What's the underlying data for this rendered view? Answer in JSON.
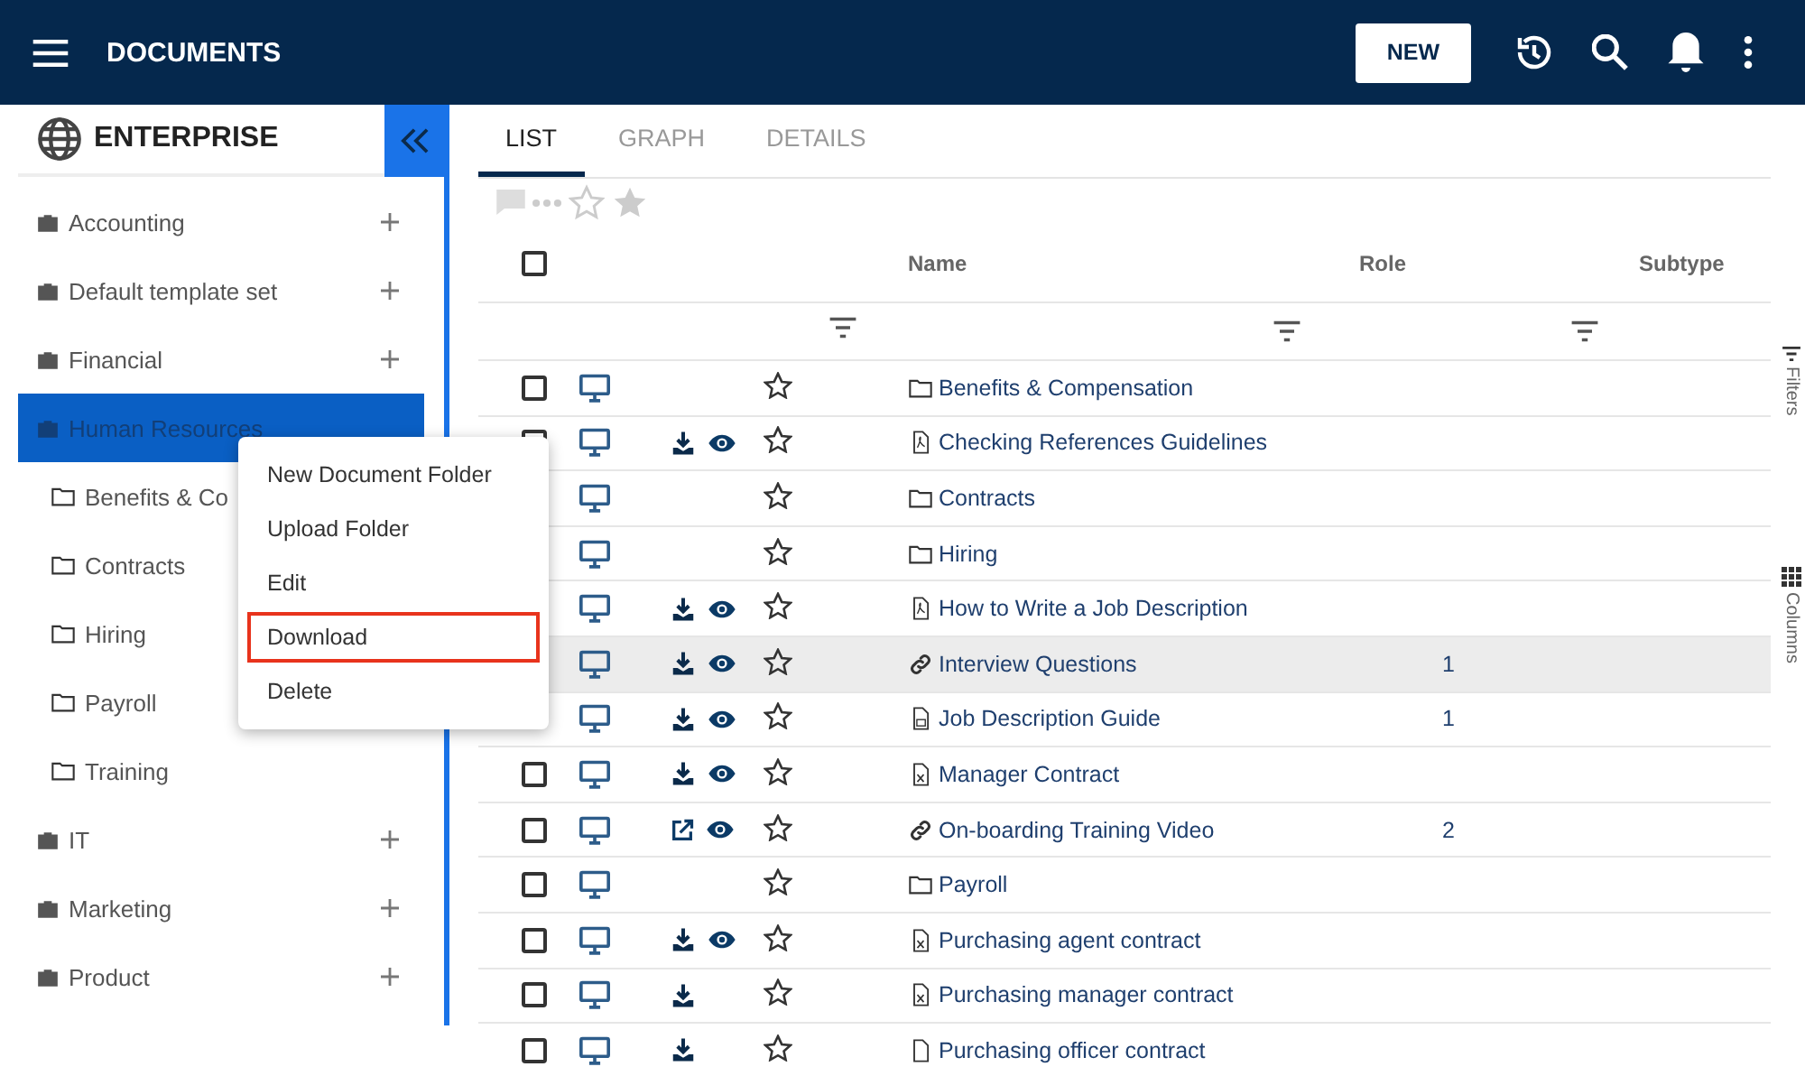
{
  "header": {
    "title": "DOCUMENTS",
    "new_button": "NEW"
  },
  "sidebar": {
    "title": "ENTERPRISE",
    "items": [
      {
        "label": "Accounting",
        "selected": false,
        "expanded": false
      },
      {
        "label": "Default template set",
        "selected": false,
        "expanded": false
      },
      {
        "label": "Financial",
        "selected": false,
        "expanded": false
      },
      {
        "label": "Human Resources",
        "selected": true,
        "expanded": true,
        "children": [
          {
            "label": "Benefits & Co",
            "selected": false
          },
          {
            "label": "Contracts",
            "selected": false
          },
          {
            "label": "Hiring",
            "selected": false
          },
          {
            "label": "Payroll",
            "selected": false
          },
          {
            "label": "Training",
            "selected": false
          }
        ]
      },
      {
        "label": "IT",
        "selected": false,
        "expanded": false
      },
      {
        "label": "Marketing",
        "selected": false,
        "expanded": false
      },
      {
        "label": "Product",
        "selected": false,
        "expanded": false
      }
    ]
  },
  "context_menu": {
    "items": [
      {
        "label": "New Document Folder",
        "selected": false
      },
      {
        "label": "Upload Folder",
        "selected": false
      },
      {
        "label": "Edit",
        "selected": false
      },
      {
        "label": "Download",
        "selected": true
      },
      {
        "label": "Delete",
        "selected": false
      }
    ]
  },
  "tabs": [
    {
      "label": "LIST",
      "selected": true
    },
    {
      "label": "GRAPH",
      "selected": false
    },
    {
      "label": "DETAILS",
      "selected": false
    }
  ],
  "table": {
    "all_checked": false,
    "columns": [
      "Name",
      "Role",
      "Subtype"
    ],
    "rows": [
      {
        "checked": false,
        "starred": false,
        "hovered": false,
        "kind": "folder",
        "name": "Benefits & Compensation",
        "actions": []
      },
      {
        "checked": false,
        "starred": false,
        "hovered": false,
        "kind": "pdf",
        "name": "Checking References Guidelines",
        "actions": [
          {
            "kind": "download"
          },
          {
            "kind": "view"
          }
        ]
      },
      {
        "starred": false,
        "hovered": false,
        "kind": "folder",
        "name": "Contracts",
        "actions": []
      },
      {
        "starred": false,
        "hovered": false,
        "kind": "folder",
        "name": "Hiring",
        "actions": []
      },
      {
        "starred": false,
        "hovered": false,
        "kind": "pdf",
        "name": "How to Write a Job Description",
        "actions": [
          {
            "kind": "download"
          },
          {
            "kind": "view"
          }
        ]
      },
      {
        "starred": false,
        "hovered": true,
        "kind": "link",
        "name": "Interview Questions",
        "role": "1",
        "actions": [
          {
            "kind": "download"
          },
          {
            "kind": "view"
          }
        ]
      },
      {
        "starred": false,
        "hovered": false,
        "kind": "word",
        "name": "Job Description Guide",
        "role": "1",
        "actions": [
          {
            "kind": "download"
          },
          {
            "kind": "view"
          }
        ]
      },
      {
        "checked": false,
        "starred": false,
        "hovered": false,
        "kind": "excel",
        "name": "Manager Contract",
        "actions": [
          {
            "kind": "download"
          },
          {
            "kind": "view"
          }
        ]
      },
      {
        "checked": false,
        "starred": false,
        "hovered": false,
        "kind": "link",
        "name": "On-boarding Training Video",
        "role": "2",
        "actions": [
          {
            "kind": "open"
          },
          {
            "kind": "view"
          }
        ]
      },
      {
        "checked": false,
        "starred": false,
        "hovered": false,
        "kind": "folder",
        "name": "Payroll",
        "actions": []
      },
      {
        "checked": false,
        "starred": false,
        "hovered": false,
        "kind": "excel",
        "name": "Purchasing agent contract",
        "actions": [
          {
            "kind": "download"
          },
          {
            "kind": "view"
          }
        ]
      },
      {
        "checked": false,
        "starred": false,
        "hovered": false,
        "kind": "excel",
        "name": "Purchasing manager contract",
        "actions": [
          {
            "kind": "download"
          }
        ]
      },
      {
        "checked": false,
        "starred": false,
        "hovered": false,
        "kind": "file",
        "name": "Purchasing officer contract",
        "actions": [
          {
            "kind": "download"
          }
        ]
      }
    ]
  },
  "rail": [
    {
      "kind": "filters",
      "label": "Filters"
    },
    {
      "kind": "columns",
      "label": "Columns"
    }
  ]
}
